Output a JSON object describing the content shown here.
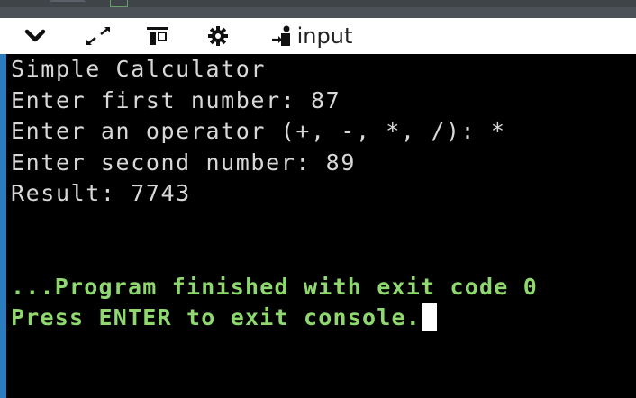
{
  "toolbar": {
    "input_label": "input"
  },
  "console": {
    "lines": [
      "Simple Calculator",
      "Enter first number: 87",
      "Enter an operator (+, -, *, /): *",
      "Enter second number: 89",
      "Result: 7743"
    ],
    "exit_message": "...Program finished with exit code 0",
    "press_enter": "Press ENTER to exit console."
  },
  "colors": {
    "toolbar_bg": "#ffffff",
    "console_bg": "#000000",
    "output_text": "#d8d8d8",
    "exit_text": "#8fd86f",
    "frame_accent": "#2a7bbf"
  },
  "icons": [
    "chevron-down-icon",
    "expand-icon",
    "panel-layout-icon",
    "gear-icon",
    "input-icon"
  ]
}
